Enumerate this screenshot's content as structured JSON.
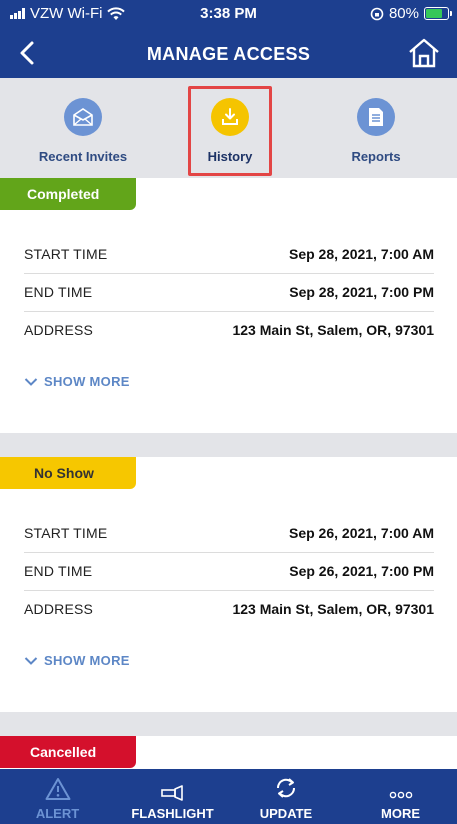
{
  "status_bar": {
    "carrier": "VZW Wi-Fi",
    "time": "3:38 PM",
    "battery": "80%",
    "battery_level": 0.8
  },
  "header": {
    "title": "MANAGE ACCESS"
  },
  "tabs": [
    {
      "label": "Recent Invites",
      "icon": "envelope-icon"
    },
    {
      "label": "History",
      "icon": "download-tray-icon"
    },
    {
      "label": "Reports",
      "icon": "document-icon"
    }
  ],
  "cards": [
    {
      "status": "Completed",
      "status_color": "#62a51a",
      "start_label": "START TIME",
      "start_value": "Sep 28, 2021, 7:00 AM",
      "end_label": "END TIME",
      "end_value": "Sep 28, 2021, 7:00 PM",
      "address_label": "ADDRESS",
      "address_value": "123 Main St, Salem, OR, 97301",
      "show_more": "SHOW MORE"
    },
    {
      "status": "No Show",
      "status_color": "#f6c700",
      "start_label": "START TIME",
      "start_value": "Sep 26, 2021, 7:00 AM",
      "end_label": "END TIME",
      "end_value": "Sep 26, 2021, 7:00 PM",
      "address_label": "ADDRESS",
      "address_value": "123 Main St, Salem, OR, 97301",
      "show_more": "SHOW MORE"
    },
    {
      "status": "Cancelled",
      "status_color": "#d4102c"
    }
  ],
  "bottom_nav": [
    {
      "label": "ALERT",
      "icon": "warning-icon"
    },
    {
      "label": "FLASHLIGHT",
      "icon": "flashlight-icon"
    },
    {
      "label": "UPDATE",
      "icon": "refresh-icon"
    },
    {
      "label": "MORE",
      "icon": "more-dots-icon"
    }
  ],
  "colors": {
    "brand": "#1d3f8f",
    "accent": "#f5c400",
    "tab_icon": "#6c93d4",
    "highlight": "#e34545",
    "link": "#5d87c6"
  }
}
